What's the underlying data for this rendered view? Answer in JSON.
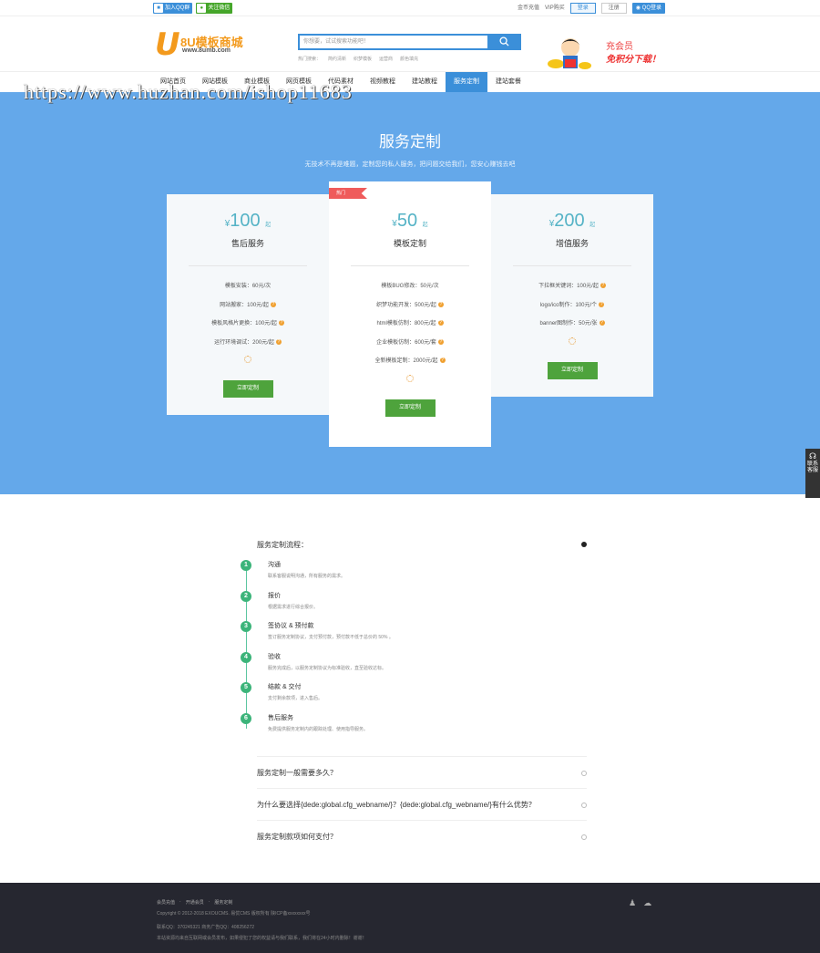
{
  "topbar": {
    "qq_group": "加入QQ群",
    "wechat": "关注微信",
    "recharge": "金币充值",
    "vip": "VIP购买",
    "login": "登录",
    "register": "注册",
    "qq_login": "QQ登录"
  },
  "header": {
    "logo_mark": "U",
    "logo_text": "8U模板商城",
    "logo_url": "www.8umb.com",
    "search_placeholder": "你想要，试试搜索功能吧！",
    "search_icon": "magnifier-icon",
    "hot_label": "热门搜索：",
    "hot_terms": [
      "简约清新",
      "织梦模板",
      "运营商",
      "颜色填充"
    ],
    "promo_line1": "充会员",
    "promo_line2": "免积分下载！"
  },
  "nav": {
    "items": [
      "网站首页",
      "网站模板",
      "商业模板",
      "网页模板",
      "代码素材",
      "视频教程",
      "建站教程",
      "服务定制",
      "建站套餐"
    ],
    "active_index": 7
  },
  "watermark": "https://www.huzhan.com/ishop11683",
  "hero": {
    "title": "服务定制",
    "subtitle": "无技术不再是难题，定制您的私人服务，把问题交给我们，您安心赚钱去吧",
    "hot_tag": "热门",
    "cards": [
      {
        "currency": "¥",
        "amount": "100",
        "unit": "起",
        "name": "售后服务",
        "items": [
          {
            "text": "模板安装：60元/次",
            "help": false
          },
          {
            "text": "网站搬家：100元/起",
            "help": true
          },
          {
            "text": "模板风格片更换：100元/起",
            "help": true
          },
          {
            "text": "运行环境调试：200元/起",
            "help": true
          }
        ],
        "button": "立即定制"
      },
      {
        "currency": "¥",
        "amount": "50",
        "unit": "起",
        "name": "模板定制",
        "items": [
          {
            "text": "模板BUG修改：50元/次",
            "help": false
          },
          {
            "text": "织梦功能开发：500元/起",
            "help": true
          },
          {
            "text": "html模板仿制：800元/起",
            "help": true
          },
          {
            "text": "企业模板仿制：600元/套",
            "help": true
          },
          {
            "text": "全新模板定制：2000元/起",
            "help": true
          }
        ],
        "button": "立即定制"
      },
      {
        "currency": "¥",
        "amount": "200",
        "unit": "起",
        "name": "增值服务",
        "items": [
          {
            "text": "下拉框关键词：100元/起",
            "help": true
          },
          {
            "text": "logo/ico制作：100元/个",
            "help": true
          },
          {
            "text": "banner图制作：50元/张",
            "help": true
          }
        ],
        "button": "立即定制"
      }
    ]
  },
  "side_float": {
    "icon": "headset-icon",
    "label": "联系客服"
  },
  "faq": {
    "process_title": "服务定制流程：",
    "steps": [
      {
        "num": "1",
        "title": "沟通",
        "desc": "联系客服说明沟通，所有服务的需求。"
      },
      {
        "num": "2",
        "title": "报价",
        "desc": "根据需求进行综合报价。"
      },
      {
        "num": "3",
        "title": "签协议 & 预付款",
        "desc": "签订服务定制协议，支付预付款，预付款不低于总价的 50% 。"
      },
      {
        "num": "4",
        "title": "验收",
        "desc": "服务完成后，以服务定制协议为标准验收，直至验收达标。"
      },
      {
        "num": "5",
        "title": "结款 & 交付",
        "desc": "支付剩余款项，进入售后。"
      },
      {
        "num": "6",
        "title": "售后服务",
        "desc": "免费提供服务定制内的跟踪处理、使用指导服务。"
      }
    ],
    "questions": [
      "服务定制一般需要多久？",
      "为什么要选择{dede:global.cfg_webname/}？{dede:global.cfg_webname/}有什么优势？",
      "服务定制款项如何支付？"
    ]
  },
  "footer": {
    "links": [
      "会员充值",
      "·",
      "开通会员",
      "·",
      "服务定制"
    ],
    "copyright": "Copyright © 2012-2018 EXOUCMS. 易优CMS 版权所有 陕ICP备xxxxxxxx号",
    "contact": "联系QQ：370245321  商务广告QQ：408256272",
    "notice": "本站资源均来自互联网或会员发布，如果侵犯了您的权益请与我们联系，我们将在24小时内删除！谢谢！",
    "social_icons": [
      "qq-icon",
      "wechat-icon"
    ]
  }
}
